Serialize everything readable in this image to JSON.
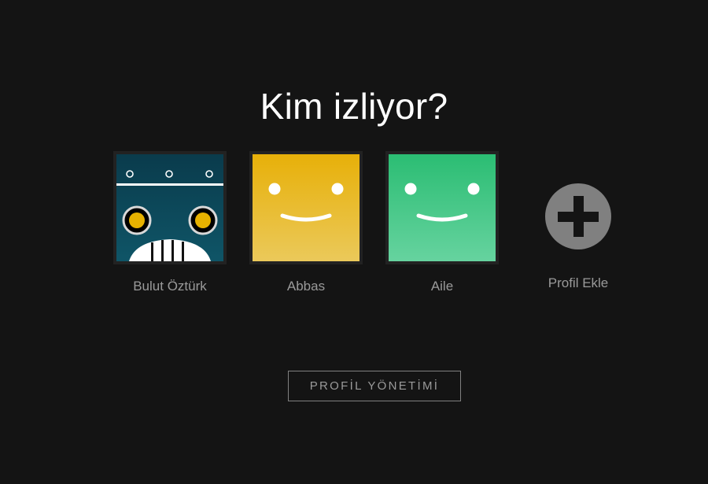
{
  "heading": "Kim izliyor?",
  "profiles": [
    {
      "name": "Bulut Öztürk",
      "avatar": "robot-avatar-icon",
      "color": "#0f4a5f"
    },
    {
      "name": "Abbas",
      "avatar": "smiley-face-icon",
      "color": "#e6b413"
    },
    {
      "name": "Aile",
      "avatar": "smiley-face-icon",
      "color": "#2bbf77"
    }
  ],
  "add_profile": {
    "label": "Profil Ekle",
    "icon": "plus-icon"
  },
  "manage_button": {
    "label": "PROFİL YÖNETİMİ"
  },
  "colors": {
    "background": "#141414",
    "text_primary": "#ffffff",
    "text_secondary": "#9a9a9a",
    "add_circle": "#808080"
  }
}
